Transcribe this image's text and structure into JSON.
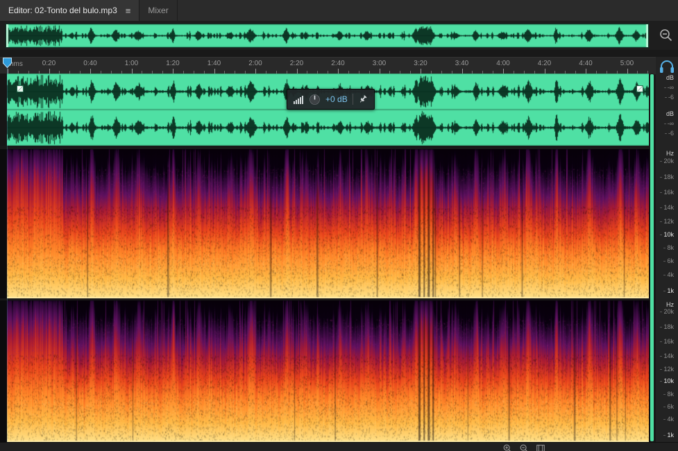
{
  "tabs": {
    "editor": {
      "label": "Editor: 02-Tonto del bulo.mp3"
    },
    "mixer": {
      "label": "Mixer"
    }
  },
  "icons": {
    "panel_menu_glyph": "≡"
  },
  "ruler": {
    "unit_label": "hms",
    "ticks": [
      "0:20",
      "0:40",
      "1:00",
      "1:20",
      "1:40",
      "2:00",
      "2:20",
      "2:40",
      "3:00",
      "3:20",
      "3:40",
      "4:00",
      "4:20",
      "4:40",
      "5:00"
    ]
  },
  "hud": {
    "gain_value": "+0 dB"
  },
  "scales": {
    "db_title": "dB",
    "db_marks": [
      "-∞",
      "-6"
    ],
    "hz_title": "Hz",
    "hz_marks": [
      "20k",
      "18k",
      "16k",
      "14k",
      "12k",
      "10k",
      "8k",
      "6k",
      "4k",
      "1k"
    ],
    "bright_marks": [
      "10k",
      "1k"
    ]
  },
  "colors": {
    "selection_green": "#4fe0a4",
    "waveform_dark": "#0a2e20",
    "accent_blue": "#3fa2e4",
    "hud_value_blue": "#7cc4ef",
    "ruler_text": "#9b9b9b",
    "scale_text": "#8f8f8f"
  }
}
